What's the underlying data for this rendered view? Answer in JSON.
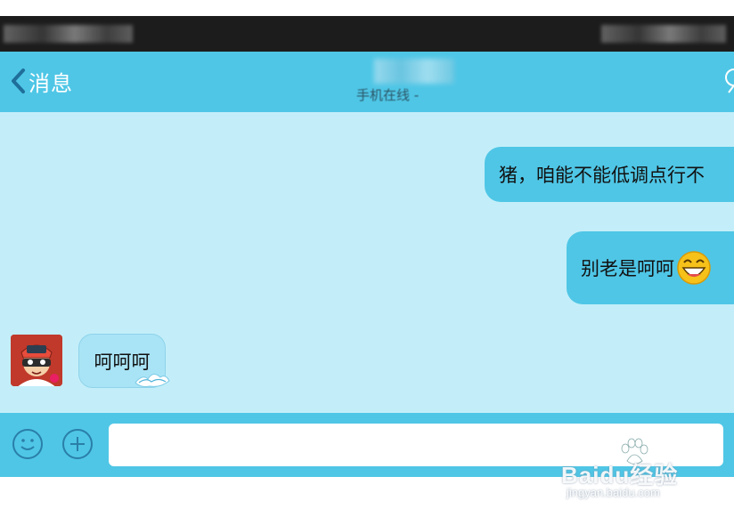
{
  "nav": {
    "back_label": "消息",
    "subtitle": "手机在线 -"
  },
  "messages": [
    {
      "side": "right",
      "text": "猪，咱能不能低调点行不"
    },
    {
      "side": "right",
      "text": "别老是呵呵",
      "emoji": "grinning-face-icon"
    },
    {
      "side": "left",
      "text": "呵呵呵",
      "avatar": "arale-avatar"
    }
  ],
  "input": {
    "value": "",
    "placeholder": ""
  },
  "watermark": {
    "main": "Baidu经验",
    "sub": "jingyan.baidu.com"
  },
  "colors": {
    "nav_bg": "#4fc6e6",
    "chat_bg": "#c3eef9",
    "bubble_in": "#a9e4f6",
    "status_bar": "#1c1c1c"
  }
}
